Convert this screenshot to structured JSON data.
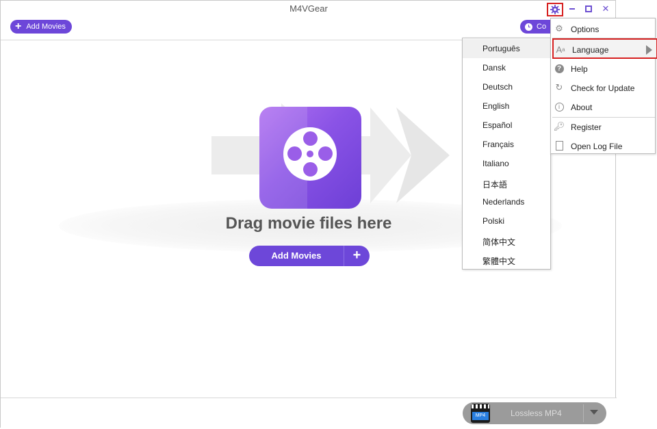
{
  "app": {
    "title": "M4VGear"
  },
  "toolbar": {
    "add_movies_label": "Add Movies",
    "convert_label": "Co"
  },
  "main": {
    "drag_text": "Drag movie files here",
    "add_button_label": "Add Movies",
    "add_plus": "+"
  },
  "bottom": {
    "format_label": "Lossless MP4",
    "format_icon_text": "MP4"
  },
  "options_menu": {
    "items": [
      {
        "label": "Options",
        "icon": "gear-icon"
      },
      {
        "label": "Language",
        "icon": "font-icon",
        "highlighted": true
      },
      {
        "label": "Help",
        "icon": "help-icon"
      },
      {
        "label": "Check for Update",
        "icon": "refresh-icon"
      },
      {
        "label": "About",
        "icon": "info-icon"
      },
      {
        "label": "Register",
        "icon": "key-icon"
      },
      {
        "label": "Open Log File",
        "icon": "document-icon"
      }
    ]
  },
  "language_menu": {
    "items": [
      "Português",
      "Dansk",
      "Deutsch",
      "English",
      "Español",
      "Français",
      "Italiano",
      "日本語",
      "Nederlands",
      "Polski",
      "简体中文",
      "繁體中文"
    ],
    "selected": "Português"
  },
  "colors": {
    "accent": "#6d47d9",
    "highlight_border": "#d62020"
  }
}
